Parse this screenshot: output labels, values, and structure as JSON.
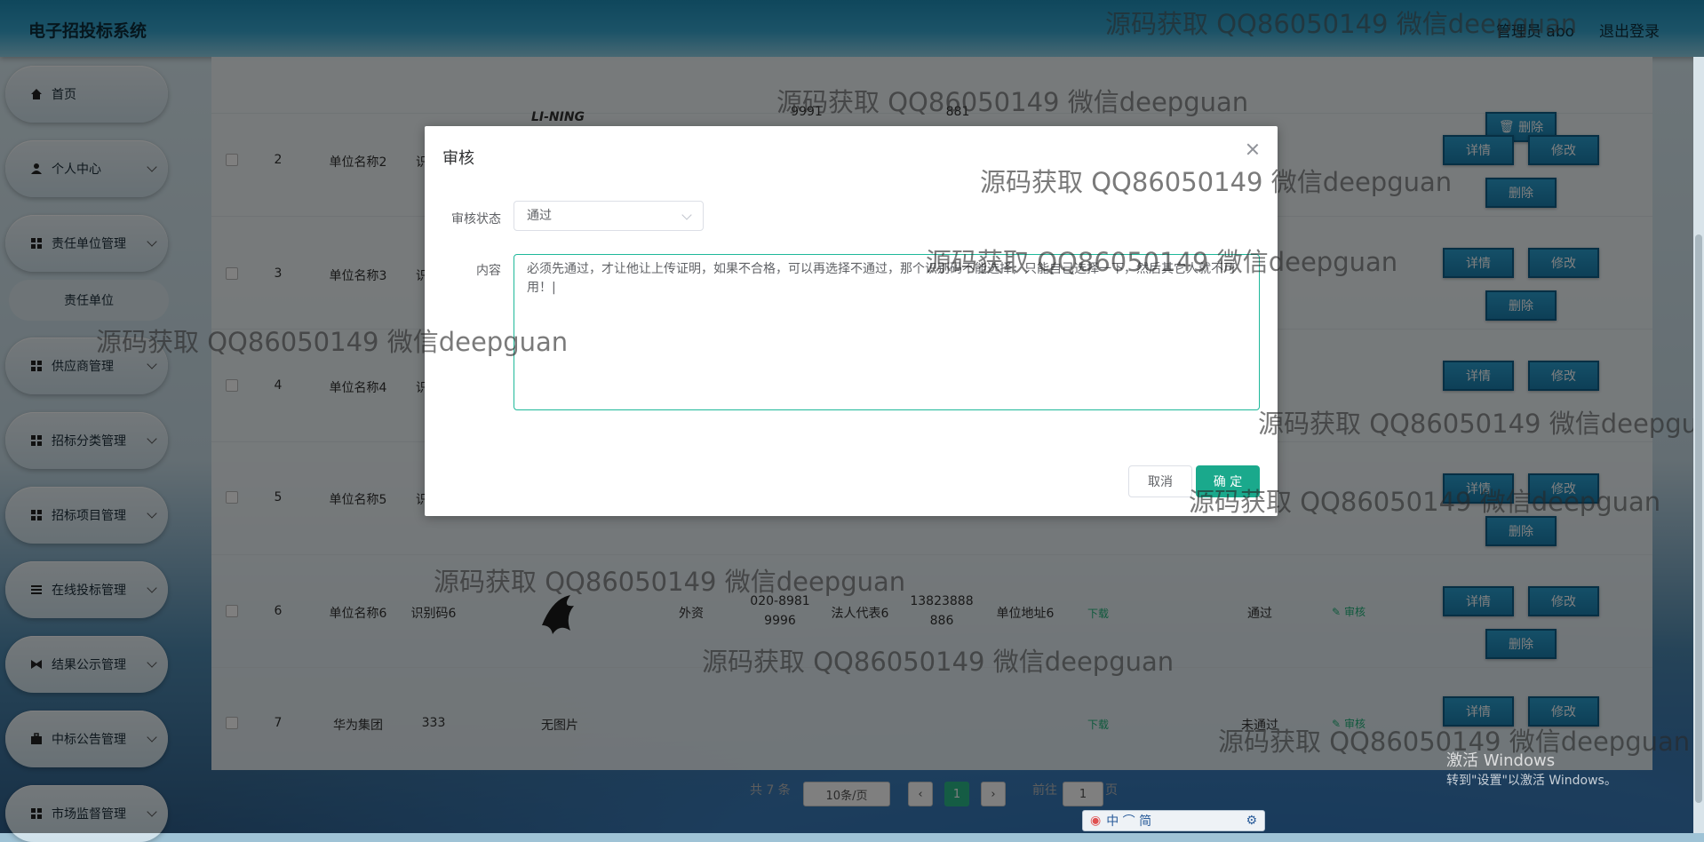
{
  "app": {
    "title": "电子招投标系统",
    "admin_label": "管理员 abo",
    "logout": "退出登录"
  },
  "sidebar": {
    "items": [
      {
        "label": "首页",
        "icon": "home-icon",
        "chevron": false
      },
      {
        "label": "个人中心",
        "icon": "user-icon",
        "chevron": true
      },
      {
        "label": "责任单位管理",
        "icon": "grid-icon",
        "chevron": true
      },
      {
        "label": "供应商管理",
        "icon": "grid-icon",
        "chevron": true
      },
      {
        "label": "招标分类管理",
        "icon": "grid-icon",
        "chevron": true
      },
      {
        "label": "招标项目管理",
        "icon": "grid-icon",
        "chevron": true
      },
      {
        "label": "在线投标管理",
        "icon": "list-icon",
        "chevron": true
      },
      {
        "label": "结果公示管理",
        "icon": "bowtie-icon",
        "chevron": true
      },
      {
        "label": "中标公告管理",
        "icon": "briefcase-icon",
        "chevron": true
      },
      {
        "label": "市场监督管理",
        "icon": "grid-icon",
        "chevron": true
      }
    ],
    "sub_item": "责任单位"
  },
  "table": {
    "partial_top": {
      "logo_text": "LI-NING",
      "phone_tail": "9991",
      "credit_tail": "881"
    },
    "rows": [
      {
        "index": "2",
        "name": "单位名称2",
        "code": "识"
      },
      {
        "index": "3",
        "name": "单位名称3",
        "code": "识"
      },
      {
        "index": "4",
        "name": "单位名称4",
        "code": "识"
      },
      {
        "index": "5",
        "name": "单位名称5",
        "code": "识"
      },
      {
        "index": "6",
        "name": "单位名称6",
        "code": "识别码6",
        "type": "外资",
        "phone1": "020-8981",
        "phone2": "9996",
        "legal": "法人代表6",
        "credit1": "13823888",
        "credit2": "886",
        "address": "单位地址6",
        "download": "下载",
        "status": "通过"
      },
      {
        "index": "7",
        "name": "华为集团",
        "code": "333",
        "image": "无图片",
        "download": "下载",
        "status": "未通过"
      }
    ],
    "actions": {
      "detail": "详情",
      "edit": "修改",
      "delete": "删除",
      "audit": "审核"
    }
  },
  "pagination": {
    "total": "共 7 条",
    "page_size": "10条/页",
    "current": "1",
    "goto_label": "前往",
    "goto_value": "1",
    "page_unit": "页"
  },
  "dialog": {
    "title": "审核",
    "status_label": "审核状态",
    "status_value": "通过",
    "content_label": "内容",
    "content_value": "必须先通过，才让他让上传证明，如果不合格，可以再选择不通过，那个识别码不能选择，只能自己选择一下，然后其它人就不可用！|",
    "cancel": "取消",
    "confirm": "确 定"
  },
  "watermark": "源码获取 QQ86050149 微信deepguan",
  "windows_activation": {
    "line1": "激活 Windows",
    "line2": "转到\"设置\"以激活 Windows。"
  },
  "ime_bar": "中 ⌒ 简"
}
